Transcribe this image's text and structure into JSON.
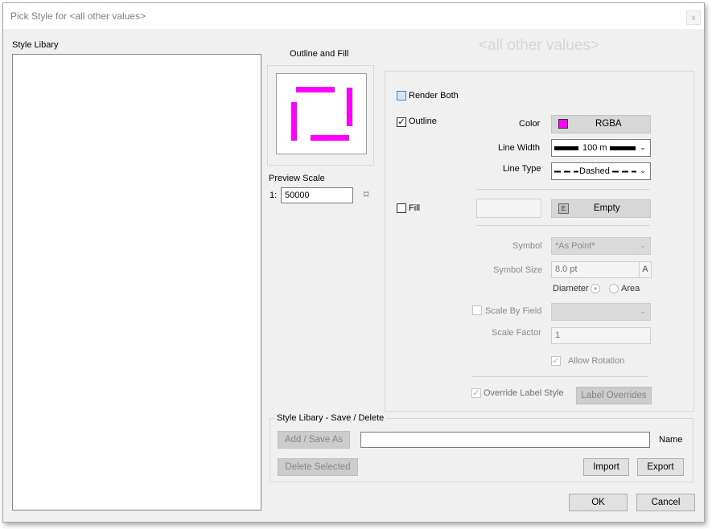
{
  "window": {
    "title": "Pick Style for <all other values>",
    "close_glyph": "x"
  },
  "library": {
    "label": "Style Libary"
  },
  "preview": {
    "heading": "Outline and Fill",
    "scale_label": "Preview Scale",
    "scale_prefix": "1:",
    "scale_value": "50000",
    "scale_icon_glyph": "⌑",
    "swatch_color": "#ff00ff"
  },
  "big_title": "<all other values>",
  "style": {
    "render_both": "Render Both",
    "outline": "Outline",
    "color_label": "Color",
    "color_button": "RGBA",
    "color_swatch": "#ff00ff",
    "line_width_label": "Line Width",
    "line_width_value": "100 m",
    "line_type_label": "Line Type",
    "line_type_value": "Dashed",
    "fill": "Fill",
    "fill_button": "Empty",
    "fill_badge": "E",
    "symbol_label": "Symbol",
    "symbol_value": "*As Point*",
    "symbol_size_label": "Symbol Size",
    "symbol_size_value": "8.0 pt",
    "symbol_size_suffix": "A",
    "diameter_label": "Diameter",
    "area_label": "Area",
    "scale_by_field": "Scale By Field",
    "scale_factor_label": "Scale Factor",
    "scale_factor_value": "1",
    "allow_rotation": "Allow Rotation",
    "override_label_style": "Override Label Style",
    "label_overrides": "Label Overrides",
    "check_glyph": "✓"
  },
  "save_group": {
    "title": "Style Libary - Save / Delete",
    "add_save": "Add /  Save As",
    "name_label": "Name",
    "name_value": "",
    "delete_selected": "Delete Selected",
    "import": "Import",
    "export": "Export"
  },
  "footer": {
    "ok": "OK",
    "cancel": "Cancel"
  },
  "icons": {
    "dropdown": "chevron-down-icon"
  }
}
